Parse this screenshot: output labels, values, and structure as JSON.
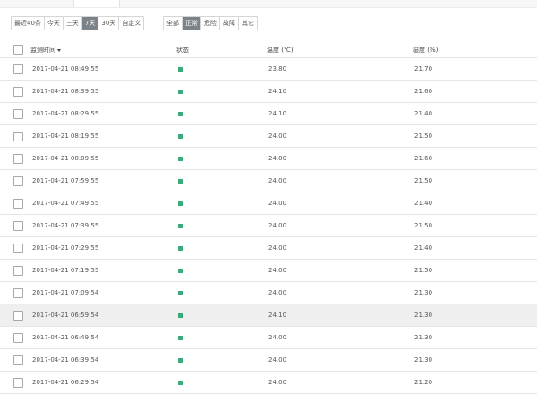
{
  "filters": {
    "time_range": [
      "最近40条",
      "今天",
      "三天",
      "7天",
      "30天",
      "自定义"
    ],
    "time_active": "7天",
    "status": [
      "全部",
      "正常",
      "危险",
      "故障",
      "其它"
    ],
    "status_active": "正常"
  },
  "table": {
    "columns": {
      "time": "监测时间",
      "status": "状态",
      "temperature": "温度 (℃)",
      "humidity": "湿度 (%)"
    },
    "sorted_column": "time",
    "sort_direction": "descending",
    "status_color": "#3aaa7a",
    "highlighted_row": 11,
    "rows": [
      {
        "time": "2017-04-21 08:49:55",
        "temperature": "23.80",
        "humidity": "21.70"
      },
      {
        "time": "2017-04-21 08:39:55",
        "temperature": "24.10",
        "humidity": "21.60"
      },
      {
        "time": "2017-04-21 08:29:55",
        "temperature": "24.10",
        "humidity": "21.40"
      },
      {
        "time": "2017-04-21 08:19:55",
        "temperature": "24.00",
        "humidity": "21.50"
      },
      {
        "time": "2017-04-21 08:09:55",
        "temperature": "24.00",
        "humidity": "21.60"
      },
      {
        "time": "2017-04-21 07:59:55",
        "temperature": "24.00",
        "humidity": "21.50"
      },
      {
        "time": "2017-04-21 07:49:55",
        "temperature": "24.00",
        "humidity": "21.40"
      },
      {
        "time": "2017-04-21 07:39:55",
        "temperature": "24.00",
        "humidity": "21.50"
      },
      {
        "time": "2017-04-21 07:29:55",
        "temperature": "24.00",
        "humidity": "21.40"
      },
      {
        "time": "2017-04-21 07:19:55",
        "temperature": "24.00",
        "humidity": "21.50"
      },
      {
        "time": "2017-04-21 07:09:54",
        "temperature": "24.00",
        "humidity": "21.30"
      },
      {
        "time": "2017-04-21 06:59:54",
        "temperature": "24.10",
        "humidity": "21.30"
      },
      {
        "time": "2017-04-21 06:49:54",
        "temperature": "24.00",
        "humidity": "21.30"
      },
      {
        "time": "2017-04-21 06:39:54",
        "temperature": "24.00",
        "humidity": "21.30"
      },
      {
        "time": "2017-04-21 06:29:54",
        "temperature": "24.00",
        "humidity": "21.20"
      }
    ]
  }
}
